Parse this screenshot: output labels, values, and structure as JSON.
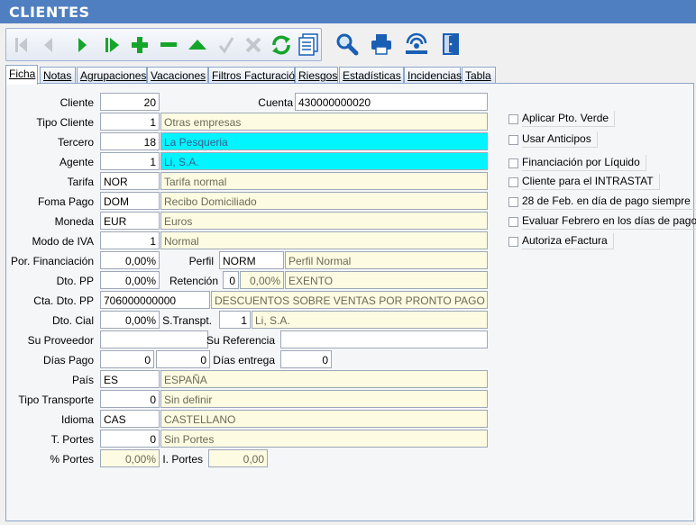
{
  "window": {
    "title": "CLIENTES"
  },
  "tabs": [
    "Ficha",
    "Notas",
    "Agrupaciones",
    "Vacaciones",
    "Filtros Facturación",
    "Riesgos",
    "Estadísticas",
    "Incidencias",
    "Tabla"
  ],
  "form": {
    "cliente": {
      "label": "Cliente",
      "value": "20"
    },
    "cuenta": {
      "label": "Cuenta",
      "value": "430000000020"
    },
    "tipo_cliente": {
      "label": "Tipo Cliente",
      "code": "1",
      "desc": "Otras empresas"
    },
    "tercero": {
      "label": "Tercero",
      "code": "18",
      "desc": "La Pesqueria"
    },
    "agente": {
      "label": "Agente",
      "code": "1",
      "desc": "Li, S.A."
    },
    "tarifa": {
      "label": "Tarifa",
      "code": "NOR",
      "desc": "Tarifa normal"
    },
    "forma_pago": {
      "label": "Foma Pago",
      "code": "DOM",
      "desc": "Recibo Domiciliado"
    },
    "moneda": {
      "label": "Moneda",
      "code": "EUR",
      "desc": "Euros"
    },
    "modo_iva": {
      "label": "Modo de IVA",
      "code": "1",
      "desc": "Normal"
    },
    "por_financiacion": {
      "label": "Por. Financiación",
      "value": "0,00%"
    },
    "perfil": {
      "label": "Perfil",
      "code": "NORM",
      "desc": "Perfil Normal"
    },
    "dto_pp": {
      "label": "Dto. PP",
      "value": "0,00%"
    },
    "retencion": {
      "label": "Retención",
      "code": "0",
      "pct": "0,00%",
      "desc": "EXENTO"
    },
    "cta_dto_pp": {
      "label": "Cta. Dto. PP",
      "code": "706000000000",
      "desc": "DESCUENTOS SOBRE VENTAS POR PRONTO PAGO DE MI"
    },
    "dto_cial": {
      "label": "Dto. Cial",
      "value": "0,00%"
    },
    "s_transpt": {
      "label": "S.Transpt.",
      "code": "1",
      "desc": "Li, S.A."
    },
    "su_proveedor": {
      "label": "Su Proveedor",
      "value": ""
    },
    "su_referencia": {
      "label": "Su Referencia",
      "value": ""
    },
    "dias_pago": {
      "label": "Días Pago",
      "value1": "0",
      "value2": "0"
    },
    "dias_entrega": {
      "label": "Días entrega",
      "value": "0"
    },
    "pais": {
      "label": "País",
      "code": "ES",
      "desc": "ESPAÑA"
    },
    "tipo_transporte": {
      "label": "Tipo Transporte",
      "code": "0",
      "desc": "Sin definir"
    },
    "idioma": {
      "label": "Idioma",
      "code": "CAS",
      "desc": "CASTELLANO"
    },
    "t_portes": {
      "label": "T. Portes",
      "code": "0",
      "desc": "Sin Portes"
    },
    "pct_portes": {
      "label": "% Portes",
      "value": "0,00%"
    },
    "i_portes": {
      "label": "I. Portes",
      "value": "0,00"
    }
  },
  "checkboxes": [
    "Aplicar Pto. Verde",
    "Usar Anticipos",
    "Financiación por Líquido",
    "Cliente para el INTRASTAT",
    "28 de Feb. en día de pago siempre",
    "Evaluar Febrero en los días de pago",
    "Autoriza eFactura"
  ],
  "toolbar": {
    "icons": [
      "first-record-icon",
      "previous-record-icon",
      "next-record-icon",
      "last-record-icon",
      "add-record-icon",
      "delete-record-icon",
      "edit-record-icon",
      "confirm-icon",
      "cancel-icon",
      "refresh-icon",
      "list-view-icon"
    ],
    "icons2": [
      "search-icon",
      "print-icon",
      "network-icon",
      "exit-icon"
    ]
  },
  "colors": {
    "title_bg": "#4f7fc0",
    "highlight_cyan": "#00f5ff",
    "readonly_yellow": "#fdfbe1",
    "icon_green": "#15a52a",
    "icon_blue": "#1a5fb4"
  }
}
